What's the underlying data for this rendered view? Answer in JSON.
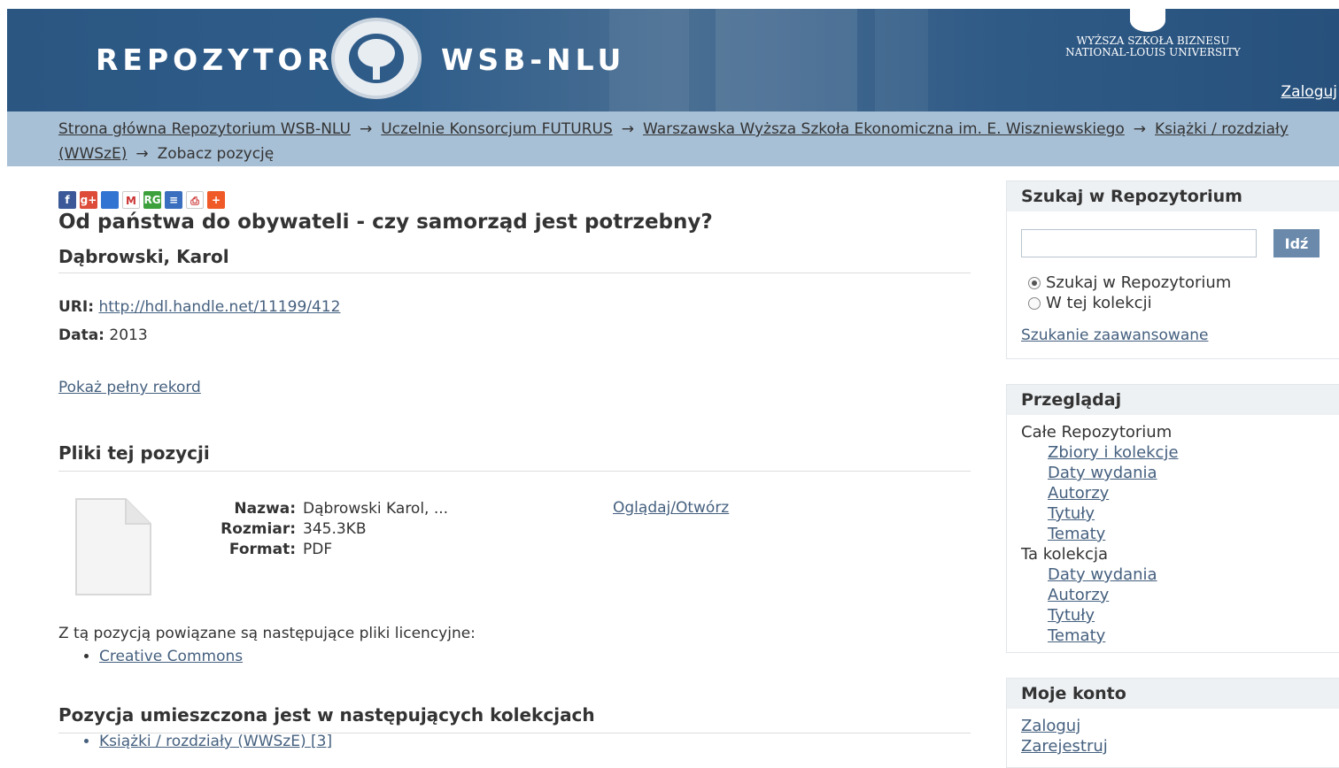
{
  "header": {
    "logo_left": "REPOZYTORIUM",
    "logo_right": "WSB-NLU",
    "school_name_line1": "WYŻSZA SZKOŁA BIZNESU",
    "school_name_line2": "NATIONAL-LOUIS UNIVERSITY",
    "login": "Zaloguj"
  },
  "breadcrumb": {
    "items": [
      "Strona główna Repozytorium WSB-NLU",
      "Uczelnie Konsorcjum FUTURUS",
      "Warszawska Wyższa Szkoła Ekonomiczna im. E. Wiszniewskiego",
      "Książki / rozdziały (WWSzE)"
    ],
    "current": "Zobacz pozycję",
    "separator": "→"
  },
  "item": {
    "title": "Od państwa do obywateli - czy samorząd jest potrzebny?",
    "author": "Dąbrowski, Karol",
    "uri_label": "URI:",
    "uri": "http://hdl.handle.net/11199/412",
    "date_label": "Data:",
    "date": "2013",
    "full_record": "Pokaż pełny rekord"
  },
  "files": {
    "heading": "Pliki tej pozycji",
    "name_label": "Nazwa:",
    "name": "Dąbrowski Karol, ...",
    "size_label": "Rozmiar:",
    "size": "345.3KB",
    "format_label": "Format:",
    "format": "PDF",
    "open": "Oglądaj/Otwórz"
  },
  "license": {
    "text": "Z tą pozycją powiązane są następujące pliki licencyjne:",
    "items": [
      "Creative Commons"
    ]
  },
  "collections": {
    "heading": "Pozycja umieszczona jest w następujących kolekcjach",
    "items": [
      "Książki / rozdziały (WWSzE) [3]"
    ]
  },
  "sidebar": {
    "search": {
      "heading": "Szukaj w Repozytorium",
      "button": "Idź",
      "scope_all": "Szukaj w Repozytorium",
      "scope_collection": "W tej kolekcji",
      "advanced": "Szukanie zaawansowane"
    },
    "browse": {
      "heading": "Przeglądaj",
      "all_label": "Całe Repozytorium",
      "all_items": [
        "Zbiory i kolekcje",
        "Daty wydania",
        "Autorzy",
        "Tytuły",
        "Tematy"
      ],
      "collection_label": "Ta kolekcja",
      "collection_items": [
        "Daty wydania",
        "Autorzy",
        "Tytuły",
        "Tematy"
      ]
    },
    "account": {
      "heading": "Moje konto",
      "login": "Zaloguj",
      "register": "Zarejestruj"
    }
  },
  "share_icons": [
    {
      "name": "facebook-icon",
      "color": "#3b5998",
      "glyph": "f"
    },
    {
      "name": "google-plus-icon",
      "color": "#dd4b39",
      "glyph": "g+"
    },
    {
      "name": "delicious-icon",
      "color": "#3274d1",
      "glyph": ""
    },
    {
      "name": "gmail-icon",
      "color": "#ffffff",
      "glyph": "M"
    },
    {
      "name": "researchgate-icon",
      "color": "#3ca13c",
      "glyph": "RG"
    },
    {
      "name": "document-icon",
      "color": "#3a6fc0",
      "glyph": "≡"
    },
    {
      "name": "print-icon",
      "color": "#ffffff",
      "glyph": "⎙"
    },
    {
      "name": "add-share-icon",
      "color": "#f05a28",
      "glyph": "+"
    }
  ]
}
